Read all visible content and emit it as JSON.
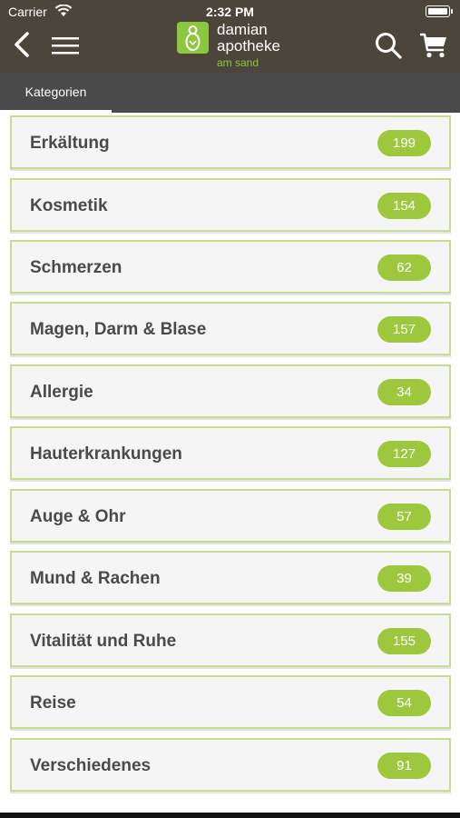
{
  "status_bar": {
    "carrier": "Carrier",
    "time": "2:32 PM"
  },
  "header": {
    "logo": {
      "line1": "damian",
      "line2": "apotheke",
      "sub": "am sand"
    },
    "icons": [
      "back-icon",
      "menu-icon",
      "search-icon",
      "cart-icon"
    ]
  },
  "tabs": [
    {
      "label": "Kategorien",
      "active": true
    }
  ],
  "categories": [
    {
      "label": "Erkältung",
      "count": "199"
    },
    {
      "label": "Kosmetik",
      "count": "154"
    },
    {
      "label": "Schmerzen",
      "count": "62"
    },
    {
      "label": "Magen, Darm & Blase",
      "count": "157"
    },
    {
      "label": "Allergie",
      "count": "34"
    },
    {
      "label": "Hauterkrankungen",
      "count": "127"
    },
    {
      "label": "Auge & Ohr",
      "count": "57"
    },
    {
      "label": "Mund & Rachen",
      "count": "39"
    },
    {
      "label": "Vitalität und Ruhe",
      "count": "155"
    },
    {
      "label": "Reise",
      "count": "54"
    },
    {
      "label": "Verschiedenes",
      "count": "91"
    }
  ],
  "colors": {
    "header_bg": "#4b453b",
    "tabbar_bg": "#4a4a4a",
    "accent_green": "#9dc83d",
    "row_border": "#c6dd8e"
  }
}
